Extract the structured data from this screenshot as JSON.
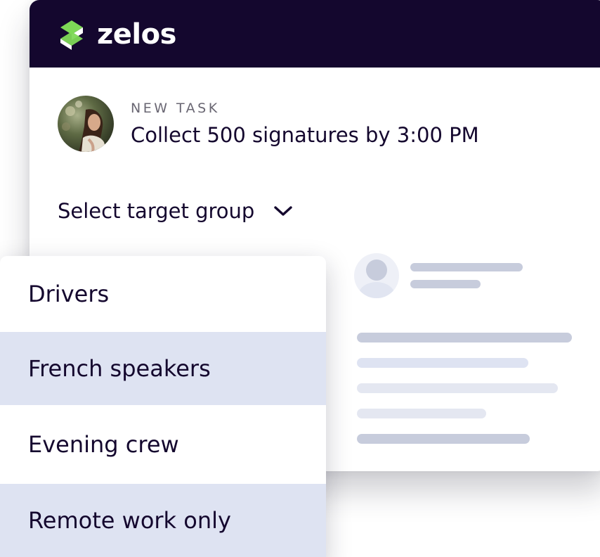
{
  "brand": {
    "name": "zelos",
    "header_color": "#14072e",
    "logo_green": "#7ed957"
  },
  "task": {
    "kicker": "NEW TASK",
    "title": "Collect 500 signatures by 3:00 PM",
    "avatar_icon": "user-photo-avatar"
  },
  "selector": {
    "label": "Select target group",
    "icon": "chevron-down-icon"
  },
  "dropdown": {
    "items": [
      {
        "label": "Drivers",
        "shaded": false
      },
      {
        "label": "French speakers",
        "shaded": true
      },
      {
        "label": "Evening crew",
        "shaded": false
      },
      {
        "label": "Remote work only",
        "shaded": true
      }
    ],
    "shade_color": "#dee3f2"
  },
  "preview": {
    "avatar_icon": "placeholder-avatar-icon",
    "placeholder_color_dark": "#c7ccdc",
    "placeholder_color_light": "#e4e7f1"
  }
}
